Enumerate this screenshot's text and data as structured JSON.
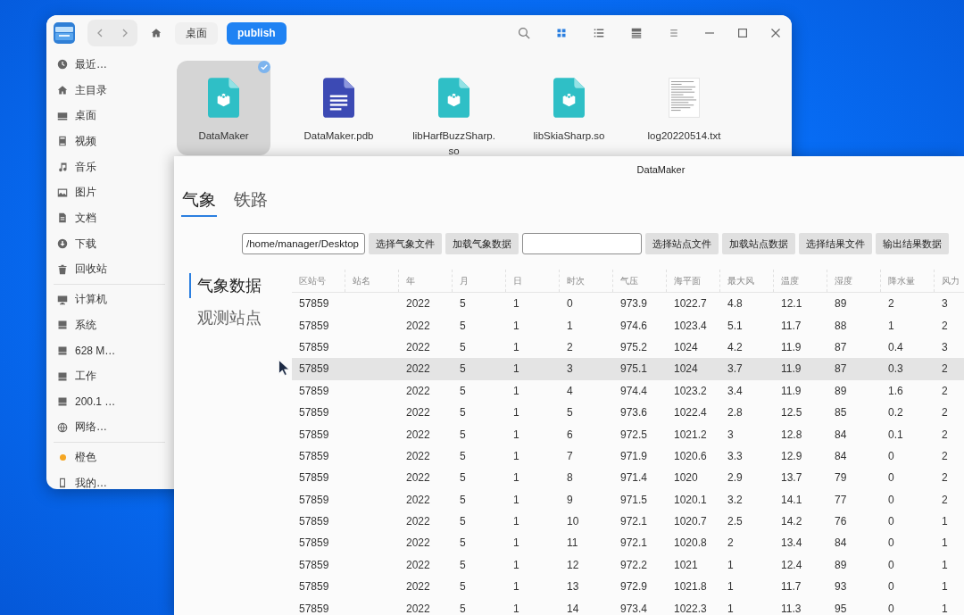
{
  "file_manager": {
    "toolbar": {
      "breadcrumbs": [
        {
          "label": "桌面",
          "selected": false
        },
        {
          "label": "publish",
          "selected": true
        }
      ],
      "view_modes": [
        {
          "kind": "icons",
          "selected": true
        },
        {
          "kind": "list",
          "selected": false
        },
        {
          "kind": "columns",
          "selected": false
        }
      ]
    },
    "sidebar": {
      "groups": [
        {
          "items": [
            {
              "kind": "recent",
              "label": "最近…"
            },
            {
              "kind": "home",
              "label": "主目录"
            },
            {
              "kind": "desktop",
              "label": "桌面"
            },
            {
              "kind": "video",
              "label": "视频"
            },
            {
              "kind": "music",
              "label": "音乐"
            },
            {
              "kind": "pictures",
              "label": "图片"
            },
            {
              "kind": "documents",
              "label": "文档"
            },
            {
              "kind": "downloads",
              "label": "下载"
            },
            {
              "kind": "trash",
              "label": "回收站"
            }
          ]
        },
        {
          "items": [
            {
              "kind": "computer",
              "label": "计算机"
            },
            {
              "kind": "disk",
              "label": "系统"
            },
            {
              "kind": "disk",
              "label": "628 M…"
            },
            {
              "kind": "disk",
              "label": "工作"
            },
            {
              "kind": "disk",
              "label": "200.1 …"
            },
            {
              "kind": "network",
              "label": "网络…"
            }
          ]
        },
        {
          "items": [
            {
              "kind": "tag",
              "label": "橙色",
              "color": "#f5a623"
            },
            {
              "kind": "phone",
              "label": "我的…"
            }
          ]
        }
      ]
    },
    "files": [
      {
        "kind": "app",
        "name": "DataMaker",
        "selected": true
      },
      {
        "kind": "document",
        "name": "DataMaker.pdb",
        "selected": false
      },
      {
        "kind": "library",
        "name": "libHarfBuzzSharp.so",
        "selected": false
      },
      {
        "kind": "library",
        "name": "libSkiaSharp.so",
        "selected": false
      },
      {
        "kind": "text",
        "name": "log20220514.txt",
        "selected": false
      }
    ]
  },
  "data_maker": {
    "window": {
      "title": "DataMaker"
    },
    "tabs": [
      {
        "label": "气象",
        "selected": true
      },
      {
        "label": "铁路",
        "selected": false
      }
    ],
    "toolbar": [
      {
        "kind": "field",
        "value": "/home/manager/Desktop"
      },
      {
        "kind": "button",
        "label": "选择气象文件"
      },
      {
        "kind": "button",
        "label": "加载气象数据"
      },
      {
        "kind": "field"
      },
      {
        "kind": "button",
        "label": "选择站点文件"
      },
      {
        "kind": "button",
        "label": "加载站点数据"
      },
      {
        "kind": "button",
        "label": "选择结果文件"
      },
      {
        "kind": "button",
        "label": "输出结果数据"
      }
    ],
    "nav": [
      {
        "label": "气象数据",
        "selected": true
      },
      {
        "label": "观测站点",
        "selected": false
      }
    ],
    "table": {
      "columns": [
        "区站号",
        "站名",
        "年",
        "月",
        "日",
        "时次",
        "气压",
        "海平面",
        "最大风",
        "温度",
        "湿度",
        "降水量",
        "风力"
      ],
      "rows": [
        {
          "selected": false,
          "cells": [
            "57859",
            null,
            "2022",
            "5",
            "1",
            "0",
            "973.9",
            "1022.7",
            "4.8",
            "12.1",
            "89",
            "2",
            "3"
          ]
        },
        {
          "selected": false,
          "cells": [
            "57859",
            null,
            "2022",
            "5",
            "1",
            "1",
            "974.6",
            "1023.4",
            "5.1",
            "11.7",
            "88",
            "1",
            "2"
          ]
        },
        {
          "selected": false,
          "cells": [
            "57859",
            null,
            "2022",
            "5",
            "1",
            "2",
            "975.2",
            "1024",
            "4.2",
            "11.9",
            "87",
            "0.4",
            "3"
          ]
        },
        {
          "selected": true,
          "cells": [
            "57859",
            null,
            "2022",
            "5",
            "1",
            "3",
            "975.1",
            "1024",
            "3.7",
            "11.9",
            "87",
            "0.3",
            "2"
          ]
        },
        {
          "selected": false,
          "cells": [
            "57859",
            null,
            "2022",
            "5",
            "1",
            "4",
            "974.4",
            "1023.2",
            "3.4",
            "11.9",
            "89",
            "1.6",
            "2"
          ]
        },
        {
          "selected": false,
          "cells": [
            "57859",
            null,
            "2022",
            "5",
            "1",
            "5",
            "973.6",
            "1022.4",
            "2.8",
            "12.5",
            "85",
            "0.2",
            "2"
          ]
        },
        {
          "selected": false,
          "cells": [
            "57859",
            null,
            "2022",
            "5",
            "1",
            "6",
            "972.5",
            "1021.2",
            "3",
            "12.8",
            "84",
            "0.1",
            "2"
          ]
        },
        {
          "selected": false,
          "cells": [
            "57859",
            null,
            "2022",
            "5",
            "1",
            "7",
            "971.9",
            "1020.6",
            "3.3",
            "12.9",
            "84",
            "0",
            "2"
          ]
        },
        {
          "selected": false,
          "cells": [
            "57859",
            null,
            "2022",
            "5",
            "1",
            "8",
            "971.4",
            "1020",
            "2.9",
            "13.7",
            "79",
            "0",
            "2"
          ]
        },
        {
          "selected": false,
          "cells": [
            "57859",
            null,
            "2022",
            "5",
            "1",
            "9",
            "971.5",
            "1020.1",
            "3.2",
            "14.1",
            "77",
            "0",
            "2"
          ]
        },
        {
          "selected": false,
          "cells": [
            "57859",
            null,
            "2022",
            "5",
            "1",
            "10",
            "972.1",
            "1020.7",
            "2.5",
            "14.2",
            "76",
            "0",
            "1"
          ]
        },
        {
          "selected": false,
          "cells": [
            "57859",
            null,
            "2022",
            "5",
            "1",
            "11",
            "972.1",
            "1020.8",
            "2",
            "13.4",
            "84",
            "0",
            "1"
          ]
        },
        {
          "selected": false,
          "cells": [
            "57859",
            null,
            "2022",
            "5",
            "1",
            "12",
            "972.2",
            "1021",
            "1",
            "12.4",
            "89",
            "0",
            "1"
          ]
        },
        {
          "selected": false,
          "cells": [
            "57859",
            null,
            "2022",
            "5",
            "1",
            "13",
            "972.9",
            "1021.8",
            "1",
            "11.7",
            "93",
            "0",
            "1"
          ]
        },
        {
          "selected": false,
          "cells": [
            "57859",
            null,
            "2022",
            "5",
            "1",
            "14",
            "973.4",
            "1022.3",
            "1",
            "11.3",
            "95",
            "0",
            "1"
          ]
        }
      ]
    }
  }
}
